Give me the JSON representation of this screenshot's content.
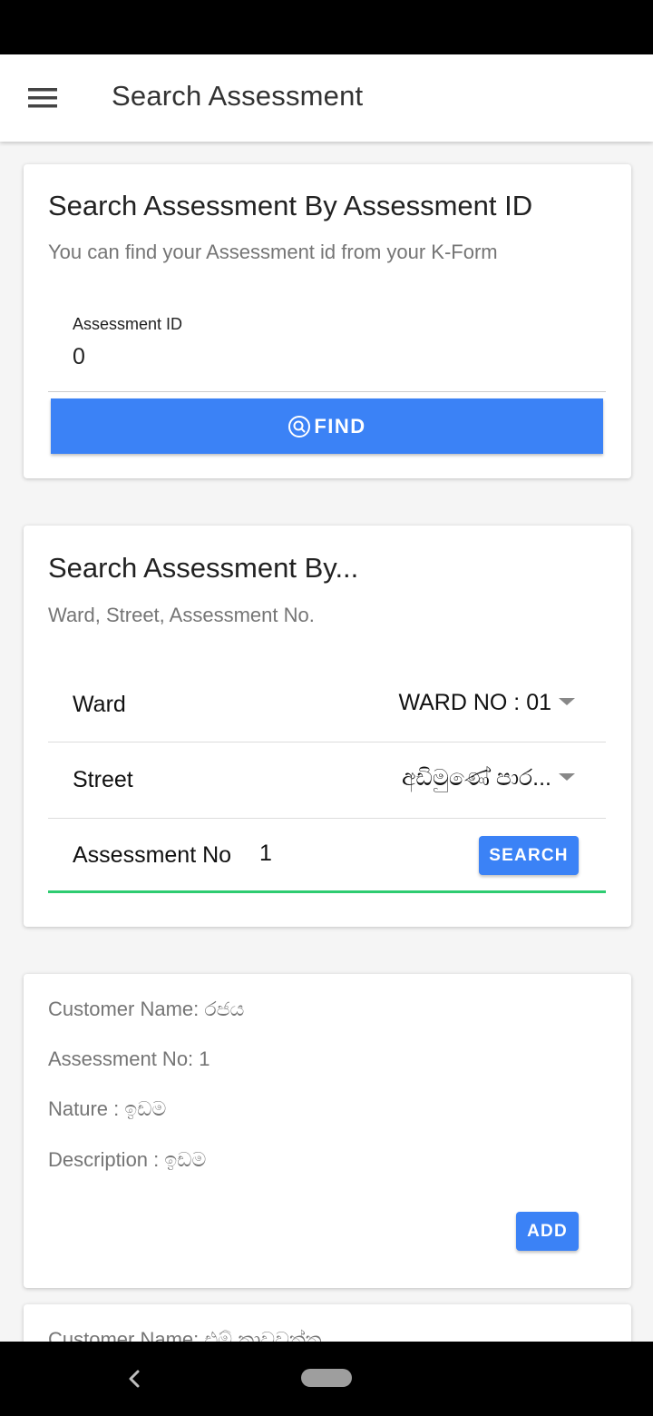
{
  "app_bar": {
    "title": "Search Assessment",
    "menu_icon": "hamburger-menu-icon"
  },
  "search_by_id": {
    "title": "Search Assessment By Assessment ID",
    "subtitle": "You can find your Assessment id from your K-Form",
    "field_label": "Assessment ID",
    "field_value": "0",
    "button_label": "FIND",
    "button_icon": "search-circle-icon"
  },
  "search_by_details": {
    "title": "Search Assessment By...",
    "subtitle": "Ward, Street, Assessment No.",
    "ward_label": "Ward",
    "ward_value": "WARD NO : 01",
    "street_label": "Street",
    "street_value": "අඩිමුණේ පාර...",
    "assessment_label": "Assessment No",
    "assessment_value": "1",
    "search_button": "SEARCH"
  },
  "results": [
    {
      "customer": "Customer Name: රජය",
      "assessment_no": "Assessment No: 1",
      "nature": "Nature : ඉඩම",
      "description": "Description : ඉඩම",
      "add_button": "ADD"
    },
    {
      "customer": "Customer Name: එම් කාවවත්ත"
    }
  ],
  "colors": {
    "primary": "#3b82f6",
    "accent_line": "#2ecc71"
  }
}
